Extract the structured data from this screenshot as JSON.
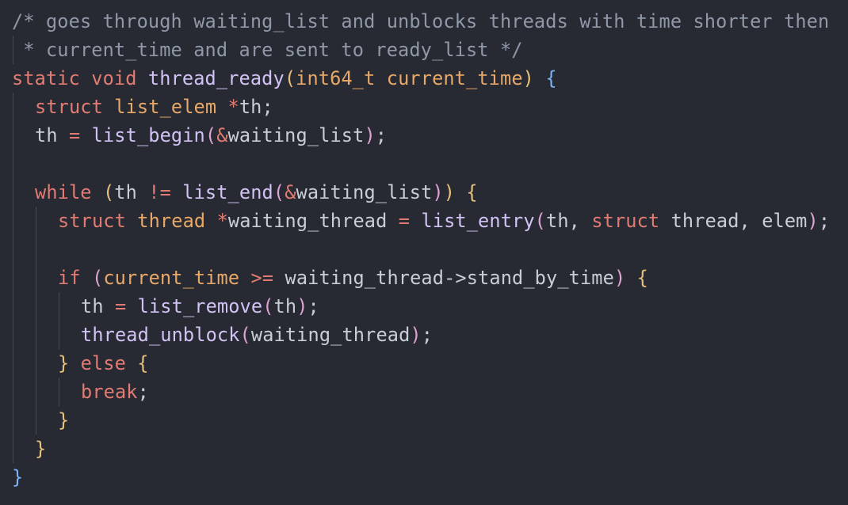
{
  "theme": {
    "background": "#272a33",
    "comment": "#9098a8",
    "keyword": "#e27b72",
    "type": "#e8a868",
    "function": "#d3c3f5",
    "text": "#c9cdd6",
    "bracket_blue": "#7cb2f7",
    "bracket_yellow": "#e5c07b",
    "bracket_pink": "#e0a2d4"
  },
  "lines": [
    {
      "indent": 0,
      "tokens": [
        {
          "t": "/* goes through waiting_list and unblocks threads with time shorter then",
          "c": "comment"
        }
      ]
    },
    {
      "indent": 0,
      "tokens": [
        {
          "t": " * current_time and are sent to ready_list */",
          "c": "comment"
        }
      ]
    },
    {
      "indent": 0,
      "tokens": [
        {
          "t": "static",
          "c": "keyword"
        },
        {
          "t": " ",
          "c": "plain"
        },
        {
          "t": "void",
          "c": "keyword"
        },
        {
          "t": " ",
          "c": "plain"
        },
        {
          "t": "thread_ready",
          "c": "func"
        },
        {
          "t": "(",
          "c": "brace2"
        },
        {
          "t": "int64_t",
          "c": "type"
        },
        {
          "t": " ",
          "c": "plain"
        },
        {
          "t": "current_time",
          "c": "param"
        },
        {
          "t": ")",
          "c": "brace2"
        },
        {
          "t": " ",
          "c": "plain"
        },
        {
          "t": "{",
          "c": "brace1"
        }
      ]
    },
    {
      "indent": 1,
      "tokens": [
        {
          "t": "struct",
          "c": "keyword"
        },
        {
          "t": " ",
          "c": "plain"
        },
        {
          "t": "list_elem",
          "c": "type"
        },
        {
          "t": " ",
          "c": "plain"
        },
        {
          "t": "*",
          "c": "op"
        },
        {
          "t": "th",
          "c": "plain"
        },
        {
          "t": ";",
          "c": "punct"
        }
      ]
    },
    {
      "indent": 1,
      "tokens": [
        {
          "t": "th",
          "c": "plain"
        },
        {
          "t": " ",
          "c": "plain"
        },
        {
          "t": "=",
          "c": "op"
        },
        {
          "t": " ",
          "c": "plain"
        },
        {
          "t": "list_begin",
          "c": "func"
        },
        {
          "t": "(",
          "c": "brace3"
        },
        {
          "t": "&",
          "c": "op"
        },
        {
          "t": "waiting_list",
          "c": "plain"
        },
        {
          "t": ")",
          "c": "brace3"
        },
        {
          "t": ";",
          "c": "punct"
        }
      ]
    },
    {
      "indent": 1,
      "tokens": []
    },
    {
      "indent": 1,
      "tokens": [
        {
          "t": "while",
          "c": "keyword"
        },
        {
          "t": " ",
          "c": "plain"
        },
        {
          "t": "(",
          "c": "brace2"
        },
        {
          "t": "th",
          "c": "plain"
        },
        {
          "t": " ",
          "c": "plain"
        },
        {
          "t": "!=",
          "c": "op"
        },
        {
          "t": " ",
          "c": "plain"
        },
        {
          "t": "list_end",
          "c": "func"
        },
        {
          "t": "(",
          "c": "brace3"
        },
        {
          "t": "&",
          "c": "op"
        },
        {
          "t": "waiting_list",
          "c": "plain"
        },
        {
          "t": ")",
          "c": "brace3"
        },
        {
          "t": ")",
          "c": "brace2"
        },
        {
          "t": " ",
          "c": "plain"
        },
        {
          "t": "{",
          "c": "brace2"
        }
      ]
    },
    {
      "indent": 2,
      "tokens": [
        {
          "t": "struct",
          "c": "keyword"
        },
        {
          "t": " ",
          "c": "plain"
        },
        {
          "t": "thread",
          "c": "type"
        },
        {
          "t": " ",
          "c": "plain"
        },
        {
          "t": "*",
          "c": "op"
        },
        {
          "t": "waiting_thread",
          "c": "plain"
        },
        {
          "t": " ",
          "c": "plain"
        },
        {
          "t": "=",
          "c": "op"
        },
        {
          "t": " ",
          "c": "plain"
        },
        {
          "t": "list_entry",
          "c": "func"
        },
        {
          "t": "(",
          "c": "brace3"
        },
        {
          "t": "th",
          "c": "plain"
        },
        {
          "t": ",",
          "c": "punct"
        },
        {
          "t": " ",
          "c": "plain"
        },
        {
          "t": "struct",
          "c": "keyword"
        },
        {
          "t": " ",
          "c": "plain"
        },
        {
          "t": "thread",
          "c": "plain"
        },
        {
          "t": ",",
          "c": "punct"
        },
        {
          "t": " ",
          "c": "plain"
        },
        {
          "t": "elem",
          "c": "plain"
        },
        {
          "t": ")",
          "c": "brace3"
        },
        {
          "t": ";",
          "c": "punct"
        }
      ]
    },
    {
      "indent": 2,
      "tokens": []
    },
    {
      "indent": 2,
      "tokens": [
        {
          "t": "if",
          "c": "keyword"
        },
        {
          "t": " ",
          "c": "plain"
        },
        {
          "t": "(",
          "c": "brace3"
        },
        {
          "t": "current_time",
          "c": "type"
        },
        {
          "t": " ",
          "c": "plain"
        },
        {
          "t": ">=",
          "c": "op"
        },
        {
          "t": " ",
          "c": "plain"
        },
        {
          "t": "waiting_thread->stand_by_time",
          "c": "plain"
        },
        {
          "t": ")",
          "c": "brace3"
        },
        {
          "t": " ",
          "c": "plain"
        },
        {
          "t": "{",
          "c": "brace2"
        }
      ]
    },
    {
      "indent": 3,
      "tokens": [
        {
          "t": "th",
          "c": "plain"
        },
        {
          "t": " ",
          "c": "plain"
        },
        {
          "t": "=",
          "c": "op"
        },
        {
          "t": " ",
          "c": "plain"
        },
        {
          "t": "list_remove",
          "c": "func"
        },
        {
          "t": "(",
          "c": "brace3"
        },
        {
          "t": "th",
          "c": "plain"
        },
        {
          "t": ")",
          "c": "brace3"
        },
        {
          "t": ";",
          "c": "punct"
        }
      ]
    },
    {
      "indent": 3,
      "tokens": [
        {
          "t": "thread_unblock",
          "c": "func"
        },
        {
          "t": "(",
          "c": "brace3"
        },
        {
          "t": "waiting_thread",
          "c": "plain"
        },
        {
          "t": ")",
          "c": "brace3"
        },
        {
          "t": ";",
          "c": "punct"
        }
      ]
    },
    {
      "indent": 2,
      "tokens": [
        {
          "t": "}",
          "c": "brace2"
        },
        {
          "t": " ",
          "c": "plain"
        },
        {
          "t": "else",
          "c": "keyword"
        },
        {
          "t": " ",
          "c": "plain"
        },
        {
          "t": "{",
          "c": "brace2"
        }
      ]
    },
    {
      "indent": 3,
      "tokens": [
        {
          "t": "break",
          "c": "keyword"
        },
        {
          "t": ";",
          "c": "punct"
        }
      ]
    },
    {
      "indent": 2,
      "tokens": [
        {
          "t": "}",
          "c": "brace2"
        }
      ]
    },
    {
      "indent": 1,
      "tokens": [
        {
          "t": "}",
          "c": "brace2"
        }
      ]
    },
    {
      "indent": 0,
      "tokens": [
        {
          "t": "}",
          "c": "brace1"
        }
      ]
    }
  ]
}
